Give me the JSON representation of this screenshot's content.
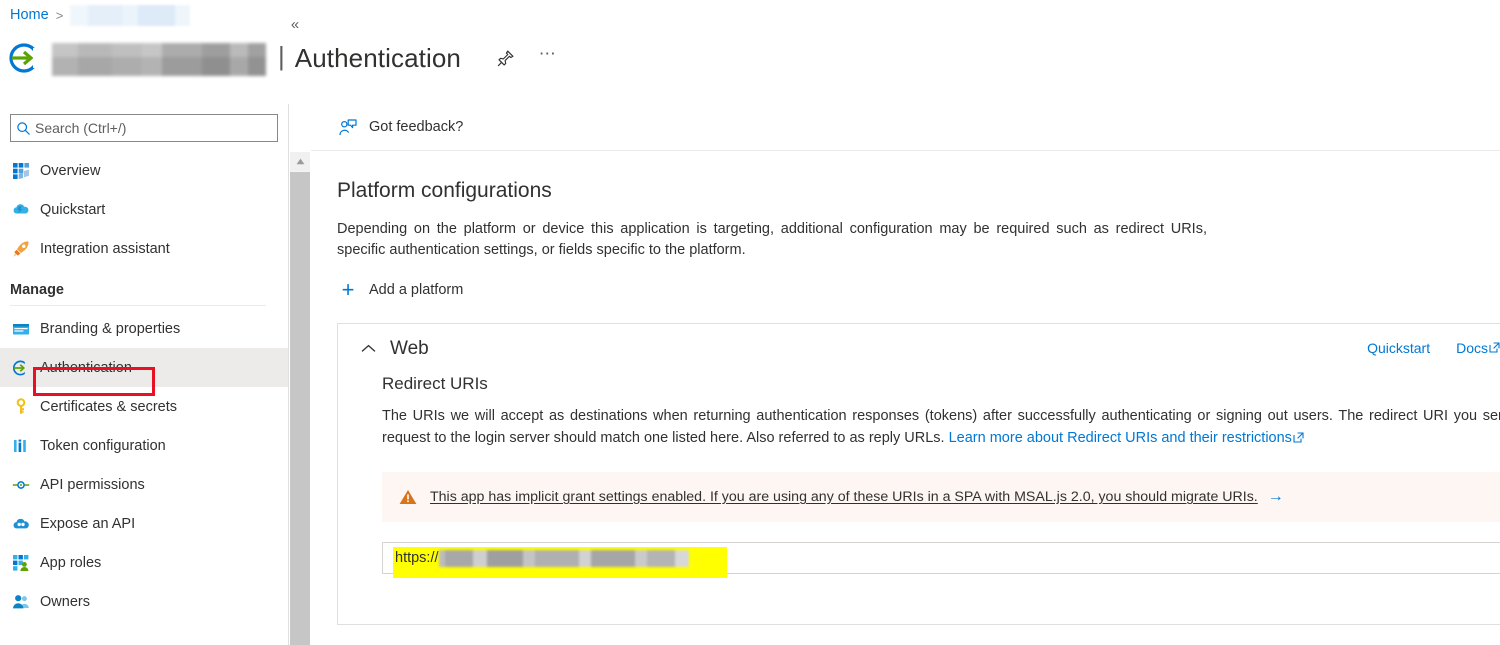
{
  "breadcrumb": {
    "home_label": "Home",
    "separator": ">",
    "redacted_item": ""
  },
  "header": {
    "app_name_redacted": "",
    "pipe": "|",
    "page_title": "Authentication",
    "pin_icon": "pin-icon",
    "more_icon": "ellipsis-icon"
  },
  "sidebar": {
    "search": {
      "placeholder": "Search (Ctrl+/)",
      "value": "",
      "icon": "search-icon"
    },
    "collapse_label": "«",
    "items": [
      {
        "label": "Overview",
        "icon": "overview-grid-icon",
        "selected": false
      },
      {
        "label": "Quickstart",
        "icon": "quickstart-cloud-icon",
        "selected": false
      },
      {
        "label": "Integration assistant",
        "icon": "rocket-icon",
        "selected": false
      }
    ],
    "group_label": "Manage",
    "manage_items": [
      {
        "label": "Branding & properties",
        "icon": "branding-icon",
        "selected": false
      },
      {
        "label": "Authentication",
        "icon": "authentication-icon",
        "selected": true
      },
      {
        "label": "Certificates & secrets",
        "icon": "key-icon",
        "selected": false
      },
      {
        "label": "Token configuration",
        "icon": "token-bars-icon",
        "selected": false
      },
      {
        "label": "API permissions",
        "icon": "api-permissions-icon",
        "selected": false
      },
      {
        "label": "Expose an API",
        "icon": "expose-api-cloud-icon",
        "selected": false
      },
      {
        "label": "App roles",
        "icon": "app-roles-icon",
        "selected": false
      },
      {
        "label": "Owners",
        "icon": "owners-people-icon",
        "selected": false
      }
    ]
  },
  "commandbar": {
    "feedback_label": "Got feedback?",
    "feedback_icon": "feedback-person-icon"
  },
  "main": {
    "heading": "Platform configurations",
    "description": "Depending on the platform or device this application is targeting, additional configuration may be required such as redirect URIs, specific authentication settings, or fields specific to the platform.",
    "add_platform_label": "Add a platform",
    "add_platform_icon": "plus-icon"
  },
  "web_card": {
    "collapse_icon": "chevron-up-icon",
    "title": "Web",
    "quickstart_link": "Quickstart",
    "docs_link": "Docs",
    "redirect_heading": "Redirect URIs",
    "redirect_description_part1": "The URIs we will accept as destinations when returning authentication responses (tokens) after successfully authenticating or signing out users. The redirect URI you send in the request to the login server should match one listed here. Also referred to as reply URLs. ",
    "redirect_link": "Learn more about Redirect URIs and their restrictions",
    "redirect_link_icon": "external-link-icon",
    "warning": {
      "icon": "warning-triangle-icon",
      "text": "This app has implicit grant settings enabled. If you are using any of these URIs in a SPA with MSAL.js 2.0, you should migrate URIs.",
      "arrow": "→"
    },
    "uri_value_prefix": "https://",
    "uri_value_redacted": ""
  },
  "annotations": {
    "red_box_target": "Authentication",
    "yellow_highlight_target": "redirect-uri-field"
  },
  "colors": {
    "accent_blue": "#0078d4",
    "selected_nav_bg": "#edebe9",
    "warning_bg": "#fdf6f3",
    "warning_orange": "#d8741a",
    "annotation_red": "#e81123",
    "annotation_yellow": "#ffff00",
    "text_primary": "#323130"
  }
}
